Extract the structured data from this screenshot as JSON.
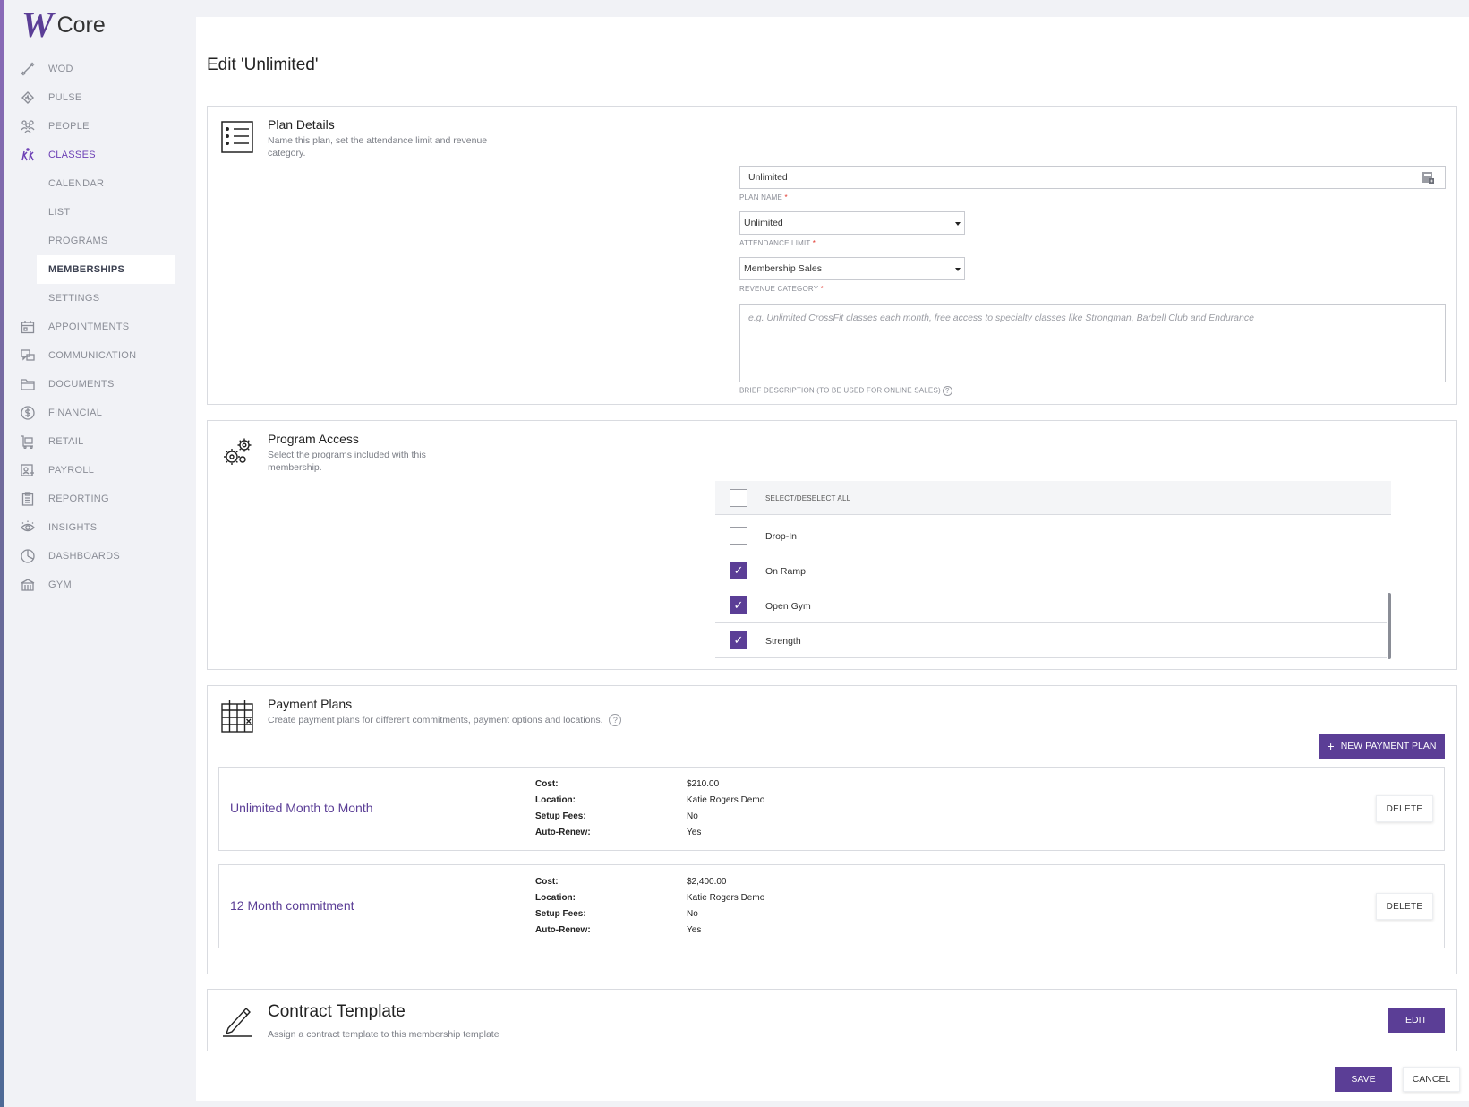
{
  "app": {
    "logo_mark": "W",
    "logo_text": "Core"
  },
  "sidebar": {
    "items": [
      {
        "label": "WOD",
        "icon": "barbell-icon"
      },
      {
        "label": "PULSE",
        "icon": "pulse-icon"
      },
      {
        "label": "PEOPLE",
        "icon": "people-icon"
      },
      {
        "label": "CLASSES",
        "icon": "classes-icon"
      },
      {
        "label": "CALENDAR"
      },
      {
        "label": "LIST"
      },
      {
        "label": "PROGRAMS"
      },
      {
        "label": "MEMBERSHIPS"
      },
      {
        "label": "SETTINGS"
      },
      {
        "label": "APPOINTMENTS",
        "icon": "calendar-icon"
      },
      {
        "label": "COMMUNICATION",
        "icon": "chat-icon"
      },
      {
        "label": "DOCUMENTS",
        "icon": "folder-icon"
      },
      {
        "label": "FINANCIAL",
        "icon": "dollar-icon"
      },
      {
        "label": "RETAIL",
        "icon": "cart-icon"
      },
      {
        "label": "PAYROLL",
        "icon": "payroll-icon"
      },
      {
        "label": "REPORTING",
        "icon": "clipboard-icon"
      },
      {
        "label": "INSIGHTS",
        "icon": "eye-icon"
      },
      {
        "label": "DASHBOARDS",
        "icon": "dashboard-icon"
      },
      {
        "label": "GYM",
        "icon": "gym-icon"
      }
    ],
    "accent": "#6c3fb5"
  },
  "page": {
    "title": "Edit 'Unlimited'"
  },
  "plan_details": {
    "title": "Plan Details",
    "desc_line1": "Name this plan, set the attendance limit and revenue",
    "desc_line2": "category.",
    "plan_name_value": "Unlimited",
    "plan_name_label": "PLAN NAME",
    "attendance_value": "Unlimited",
    "attendance_label": "ATTENDANCE LIMIT",
    "revenue_value": "Membership Sales",
    "revenue_label": "REVENUE CATEGORY",
    "description_placeholder": "e.g. Unlimited CrossFit classes each month, free access to specialty classes like Strongman, Barbell Club and Endurance",
    "description_label": "BRIEF DESCRIPTION (TO BE USED FOR ONLINE SALES)",
    "required_mark": "*",
    "help_mark": "?"
  },
  "program_access": {
    "title": "Program Access",
    "desc_line1": "Select the programs included with this",
    "desc_line2": "membership.",
    "select_all_label": "SELECT/DESELECT ALL",
    "check_mark": "✓",
    "programs": [
      {
        "label": "Drop-In",
        "checked": false
      },
      {
        "label": "On Ramp",
        "checked": true
      },
      {
        "label": "Open Gym",
        "checked": true
      },
      {
        "label": "Strength",
        "checked": true
      }
    ]
  },
  "payment_plans": {
    "title": "Payment Plans",
    "desc": "Create payment plans for different commitments, payment options and locations.",
    "help_mark": "?",
    "new_button": "NEW PAYMENT PLAN",
    "new_button_icon": "+",
    "delete_label": "DELETE",
    "labels": {
      "cost": "Cost:",
      "location": "Location:",
      "setup": "Setup Fees:",
      "renew": "Auto-Renew:"
    },
    "plans": [
      {
        "name": "Unlimited Month to Month",
        "cost": "$210.00",
        "location": "Katie Rogers Demo",
        "setup": "No",
        "renew": "Yes"
      },
      {
        "name": "12 Month commitment",
        "cost": "$2,400.00",
        "location": "Katie Rogers Demo",
        "setup": "No",
        "renew": "Yes"
      }
    ]
  },
  "contract": {
    "title": "Contract Template",
    "desc": "Assign a contract template to this membership template",
    "edit_button": "EDIT"
  },
  "footer": {
    "save": "SAVE",
    "cancel": "CANCEL"
  },
  "colors": {
    "brand": "#5b3e96",
    "accent": "#6c3fb5",
    "required": "#e0342b"
  }
}
